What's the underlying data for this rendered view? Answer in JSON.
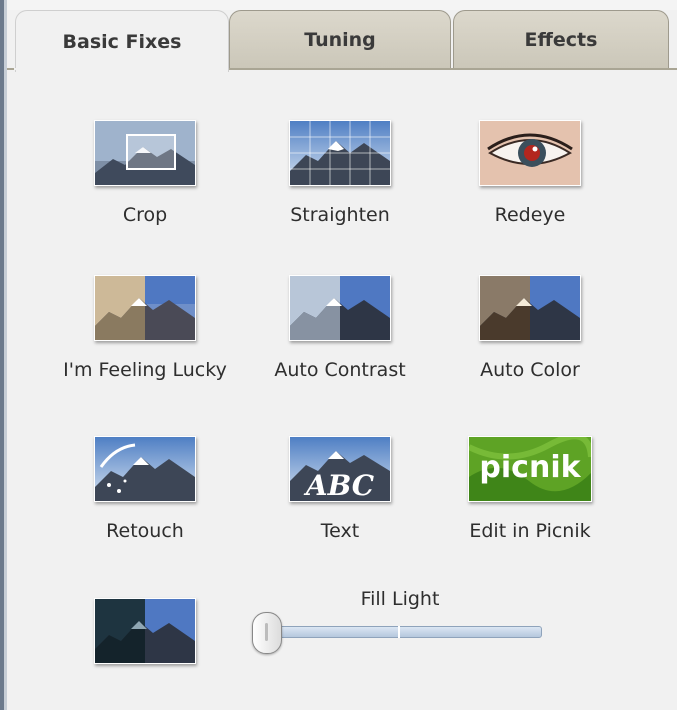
{
  "tabs": [
    {
      "label": "Basic Fixes",
      "active": true
    },
    {
      "label": "Tuning",
      "active": false
    },
    {
      "label": "Effects",
      "active": false
    }
  ],
  "tools": [
    {
      "label": "Crop",
      "icon": "crop-icon"
    },
    {
      "label": "Straighten",
      "icon": "straighten-icon"
    },
    {
      "label": "Redeye",
      "icon": "redeye-icon"
    },
    {
      "label": "I'm Feeling Lucky",
      "icon": "feeling-lucky-icon"
    },
    {
      "label": "Auto Contrast",
      "icon": "auto-contrast-icon"
    },
    {
      "label": "Auto Color",
      "icon": "auto-color-icon"
    },
    {
      "label": "Retouch",
      "icon": "retouch-icon"
    },
    {
      "label": "Text",
      "icon": "text-icon"
    },
    {
      "label": "Edit in Picnik",
      "icon": "picnik-logo"
    }
  ],
  "thumb_text": {
    "abc": "ABC",
    "picnik": "picnik"
  },
  "fill_light": {
    "label": "Fill Light",
    "icon": "fill-light-icon",
    "value": 0
  },
  "colors": {
    "tab_inactive": "#cfcbbd",
    "panel": "#f1f1f1",
    "picnik_green": "#6fb22b"
  }
}
